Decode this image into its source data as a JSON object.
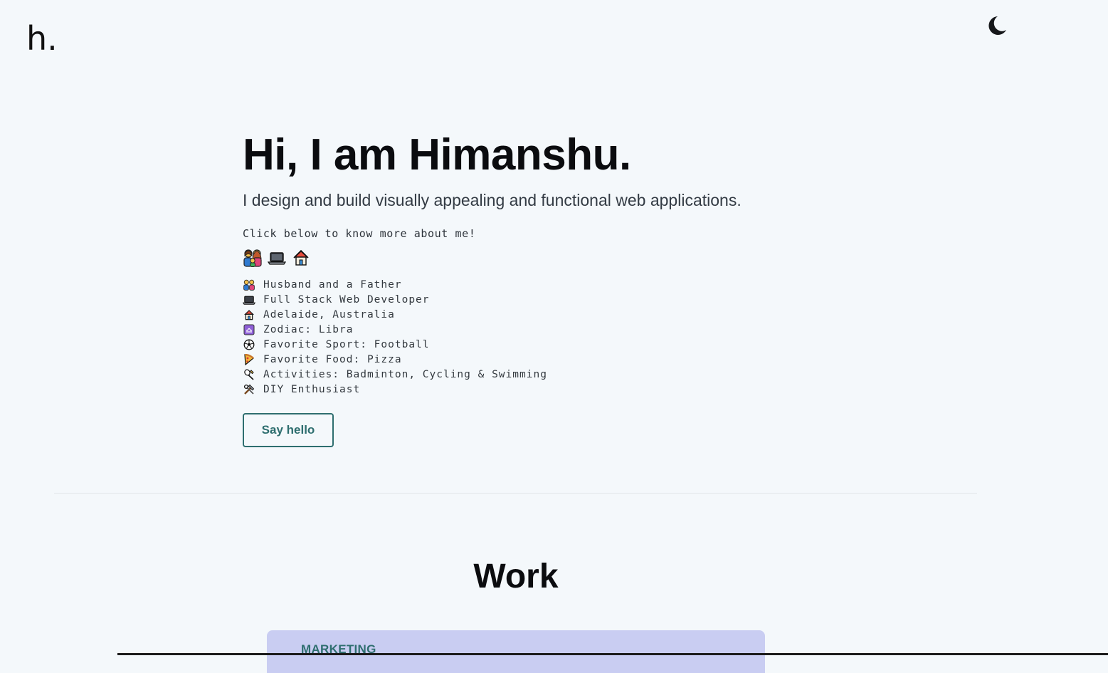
{
  "header": {
    "logo_text": "h.",
    "theme_toggle_icon": "moon-icon"
  },
  "hero": {
    "title": "Hi, I am Himanshu.",
    "subtitle": "I design and build visually appealing and functional web applications.",
    "prompt": "Click below to know more about me!",
    "emoji_buttons": [
      {
        "icon": "family-icon"
      },
      {
        "icon": "laptop-icon"
      },
      {
        "icon": "house-icon"
      }
    ],
    "facts": [
      {
        "icon": "family-icon",
        "text": "Husband and a Father"
      },
      {
        "icon": "laptop-icon",
        "text": "Full Stack Web Developer"
      },
      {
        "icon": "house-icon",
        "text": "Adelaide, Australia"
      },
      {
        "icon": "libra-icon",
        "text": "Zodiac: Libra"
      },
      {
        "icon": "soccer-ball-icon",
        "text": "Favorite Sport: Football"
      },
      {
        "icon": "pizza-icon",
        "text": "Favorite Food: Pizza"
      },
      {
        "icon": "badminton-icon",
        "text": "Activities: Badminton, Cycling & Swimming"
      },
      {
        "icon": "tools-icon",
        "text": "DIY Enthusiast"
      }
    ],
    "cta_label": "Say hello"
  },
  "work": {
    "title": "Work",
    "card_tag": "MARKETING"
  },
  "colors": {
    "background": "#f4f8fb",
    "accent": "#2e6e6f",
    "card": "#c9cdf2"
  }
}
